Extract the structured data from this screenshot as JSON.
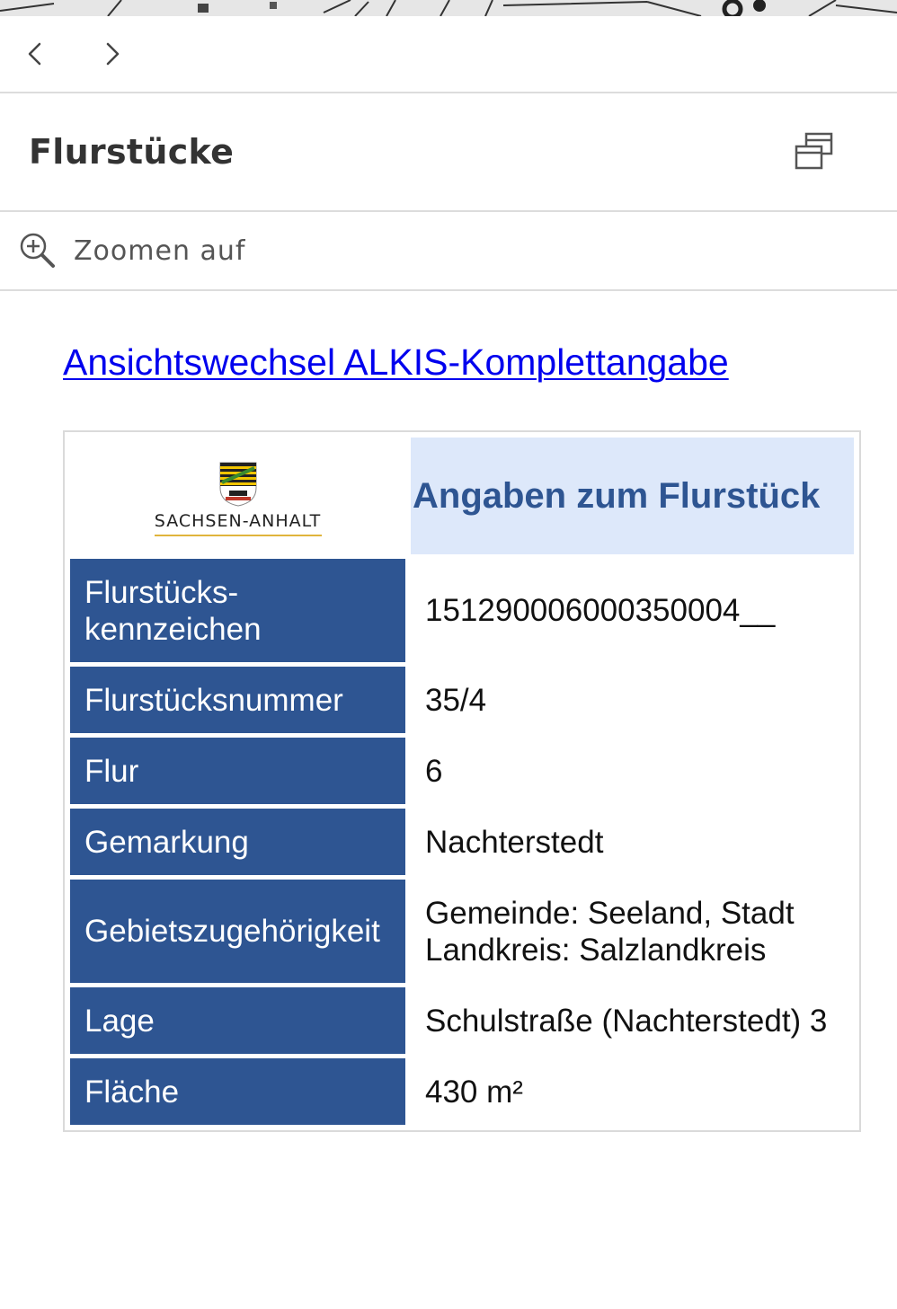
{
  "nav": {
    "back_glyph": "‹",
    "forward_glyph": "›"
  },
  "panel": {
    "title": "Flurstücke",
    "restore_icon": "restore-window-icon"
  },
  "zoom": {
    "label": "Zoomen auf",
    "icon": "zoom-in-icon"
  },
  "view_link": "Ansichtswechsel ALKIS-Komplettangabe",
  "table": {
    "logo_text": "SACHSEN-ANHALT",
    "heading": "Angaben zum Flurstück",
    "rows": [
      {
        "label_line1": "Flurstücks-",
        "label_line2": "kennzeichen",
        "value": "151290006000350004__"
      },
      {
        "label": "Flurstücksnummer",
        "value": "35/4"
      },
      {
        "label": "Flur",
        "value": "6"
      },
      {
        "label": "Gemarkung",
        "value": "Nachterstedt"
      },
      {
        "label": "Gebietszugehörigkeit",
        "value_line1": "Gemeinde: Seeland, Stadt",
        "value_line2": "Landkreis: Salzlandkreis"
      },
      {
        "label": "Lage",
        "value": "Schulstraße (Nachterstedt) 3"
      },
      {
        "label": "Fläche",
        "value": "430 m²"
      }
    ]
  },
  "colors": {
    "label_bg": "#2e5592",
    "heading_bg": "#dde8fa",
    "heading_text": "#2e5592",
    "link": "#0000ee"
  }
}
